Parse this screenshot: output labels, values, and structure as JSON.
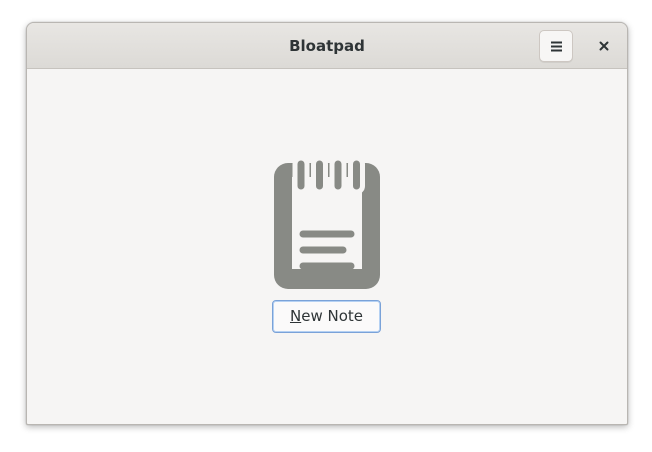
{
  "window": {
    "title": "Bloatpad"
  },
  "headerbar": {
    "menu_icon": "hamburger-menu-icon",
    "close_icon": "close-icon"
  },
  "empty_state": {
    "icon": "notepad-icon",
    "button_mnemonic": "N",
    "button_rest": "ew Note"
  },
  "colors": {
    "window_bg": "#f6f5f4",
    "headerbar_bg": "#dedbd7",
    "icon_gray": "#888a85",
    "focus_blue": "#7aa2d8",
    "text": "#2e3436"
  }
}
